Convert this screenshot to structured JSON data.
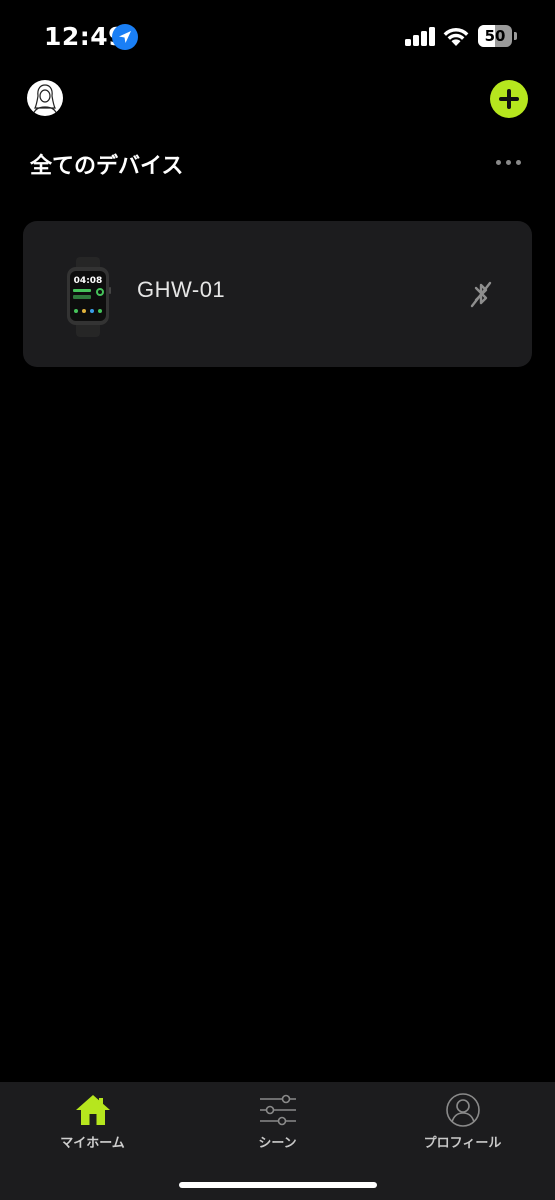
{
  "status_bar": {
    "time": "12:49",
    "battery_level": "50",
    "icons": [
      "location-icon",
      "cellular-signal-icon",
      "wifi-icon",
      "battery-icon"
    ]
  },
  "header": {
    "avatar_icon": "user-avatar-icon",
    "add_icon": "plus-icon",
    "accent_color": "#b6e61e"
  },
  "section": {
    "title": "全てのデバイス",
    "more_icon": "more-dots-icon"
  },
  "devices": [
    {
      "name": "GHW-01",
      "watch_time": "04:08",
      "image_icon": "smartwatch-icon",
      "status_icon": "bluetooth-disconnected-icon"
    }
  ],
  "tabs": [
    {
      "label": "マイホーム",
      "icon": "home-icon",
      "active": true
    },
    {
      "label": "シーン",
      "icon": "sliders-icon",
      "active": false
    },
    {
      "label": "プロフィール",
      "icon": "profile-icon",
      "active": false
    }
  ]
}
